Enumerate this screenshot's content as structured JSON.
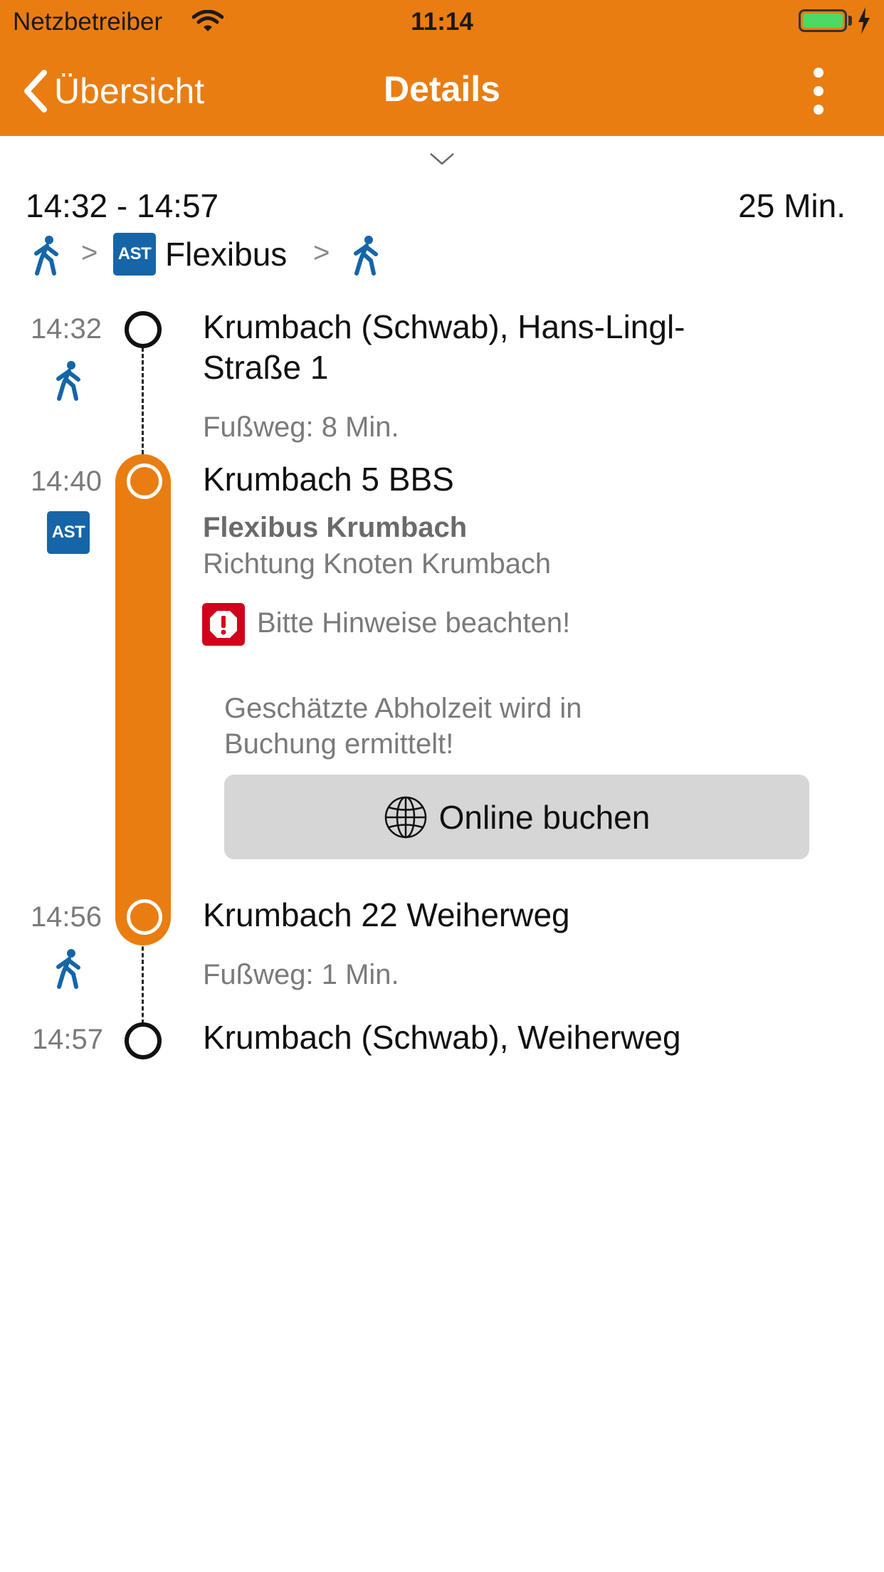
{
  "status_bar": {
    "carrier": "Netzbetreiber",
    "time": "11:14"
  },
  "nav": {
    "back_label": "Übersicht",
    "title": "Details"
  },
  "summary": {
    "time_range": "14:32 - 14:57",
    "duration": "25 Min.",
    "separator": ">",
    "badge": "AST",
    "mode_label": "Flexibus"
  },
  "timeline": {
    "stop1": {
      "time": "14:32",
      "name_line1": "Krumbach (Schwab), Hans-Lingl-",
      "name_line2": "Straße 1"
    },
    "walk1": "Fußweg: 8 Min.",
    "stop2": {
      "time": "14:40",
      "badge": "AST",
      "name": "Krumbach 5 BBS"
    },
    "line": {
      "name": "Flexibus Krumbach",
      "direction": "Richtung Knoten Krumbach"
    },
    "warning": "Bitte Hinweise beachten!",
    "pickup_line1": "Geschätzte Abholzeit wird in",
    "pickup_line2": "Buchung ermittelt!",
    "book_button": "Online buchen",
    "stop3": {
      "time": "14:56",
      "name": "Krumbach 22 Weiherweg"
    },
    "walk2": "Fußweg: 1 Min.",
    "stop4": {
      "time": "14:57",
      "name": "Krumbach (Schwab), Weiherweg"
    }
  },
  "colors": {
    "accent": "#E97D12",
    "badge": "#1565A8",
    "warning": "#D0021B"
  },
  "icons": [
    "wifi-icon",
    "battery-icon",
    "charging-icon",
    "back-chevron-icon",
    "more-vertical-icon",
    "chevron-down-icon",
    "walk-icon",
    "ast-icon",
    "warning-icon",
    "globe-icon"
  ]
}
